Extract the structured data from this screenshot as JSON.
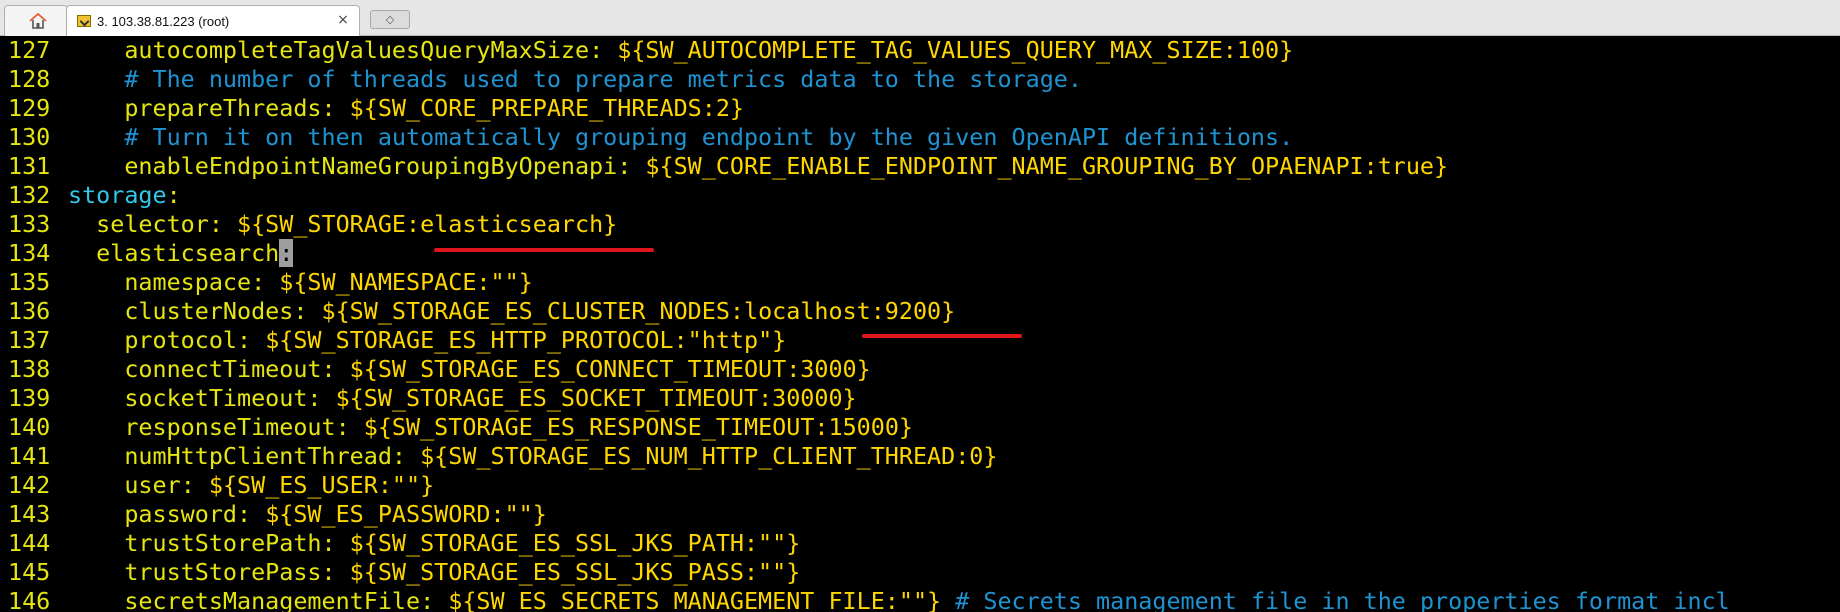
{
  "tabs": {
    "home_icon": "home-icon",
    "session_tab": {
      "title": "3. 103.38.81.223 (root)",
      "close": "×"
    },
    "new_tab_glyph": "◇"
  },
  "terminal": {
    "colors": {
      "line_number": "#e5e510",
      "key": "#e5e510",
      "comment": "#1f93d2",
      "section": "#33c6e8",
      "underline": "#e0161d"
    },
    "lines": [
      {
        "num": "127",
        "indent": "    ",
        "key": "autocompleteTagValuesQueryMaxSize",
        "sep": ": ",
        "val": "${SW_AUTOCOMPLETE_TAG_VALUES_QUERY_MAX_SIZE:100}"
      },
      {
        "num": "128",
        "indent": "    ",
        "comment": "# The number of threads used to prepare metrics data to the storage."
      },
      {
        "num": "129",
        "indent": "    ",
        "key": "prepareThreads",
        "sep": ": ",
        "val": "${SW_CORE_PREPARE_THREADS:2}"
      },
      {
        "num": "130",
        "indent": "    ",
        "comment": "# Turn it on then automatically grouping endpoint by the given OpenAPI definitions."
      },
      {
        "num": "131",
        "indent": "    ",
        "key": "enableEndpointNameGroupingByOpenapi",
        "sep": ": ",
        "val": "${SW_CORE_ENABLE_ENDPOINT_NAME_GROUPING_BY_OPAENAPI:true}"
      },
      {
        "num": "132",
        "indent": "",
        "section": "storage",
        "sep": ":"
      },
      {
        "num": "133",
        "indent": "  ",
        "key": "selector",
        "sep": ": ",
        "val": "${SW_STORAGE:elasticsearch}"
      },
      {
        "num": "134",
        "indent": "  ",
        "key": "elasticsearch",
        "cursor": ":"
      },
      {
        "num": "135",
        "indent": "    ",
        "key": "namespace",
        "sep": ": ",
        "val": "${SW_NAMESPACE:\"\"}"
      },
      {
        "num": "136",
        "indent": "    ",
        "key": "clusterNodes",
        "sep": ": ",
        "val": "${SW_STORAGE_ES_CLUSTER_NODES:localhost:9200}"
      },
      {
        "num": "137",
        "indent": "    ",
        "key": "protocol",
        "sep": ": ",
        "val": "${SW_STORAGE_ES_HTTP_PROTOCOL:\"http\"}"
      },
      {
        "num": "138",
        "indent": "    ",
        "key": "connectTimeout",
        "sep": ": ",
        "val": "${SW_STORAGE_ES_CONNECT_TIMEOUT:3000}"
      },
      {
        "num": "139",
        "indent": "    ",
        "key": "socketTimeout",
        "sep": ": ",
        "val": "${SW_STORAGE_ES_SOCKET_TIMEOUT:30000}"
      },
      {
        "num": "140",
        "indent": "    ",
        "key": "responseTimeout",
        "sep": ": ",
        "val": "${SW_STORAGE_ES_RESPONSE_TIMEOUT:15000}"
      },
      {
        "num": "141",
        "indent": "    ",
        "key": "numHttpClientThread",
        "sep": ": ",
        "val": "${SW_STORAGE_ES_NUM_HTTP_CLIENT_THREAD:0}"
      },
      {
        "num": "142",
        "indent": "    ",
        "key": "user",
        "sep": ": ",
        "val": "${SW_ES_USER:\"\"}"
      },
      {
        "num": "143",
        "indent": "    ",
        "key": "password",
        "sep": ": ",
        "val": "${SW_ES_PASSWORD:\"\"}"
      },
      {
        "num": "144",
        "indent": "    ",
        "key": "trustStorePath",
        "sep": ": ",
        "val": "${SW_STORAGE_ES_SSL_JKS_PATH:\"\"}"
      },
      {
        "num": "145",
        "indent": "    ",
        "key": "trustStorePass",
        "sep": ": ",
        "val": "${SW_STORAGE_ES_SSL_JKS_PASS:\"\"}"
      },
      {
        "num": "146",
        "indent": "    ",
        "key": "secretsManagementFile",
        "sep": ": ",
        "val": "${SW_ES_SECRETS_MANAGEMENT_FILE:\"\"}",
        "trail_comment": " # Secrets management file in the properties format incl"
      }
    ]
  }
}
